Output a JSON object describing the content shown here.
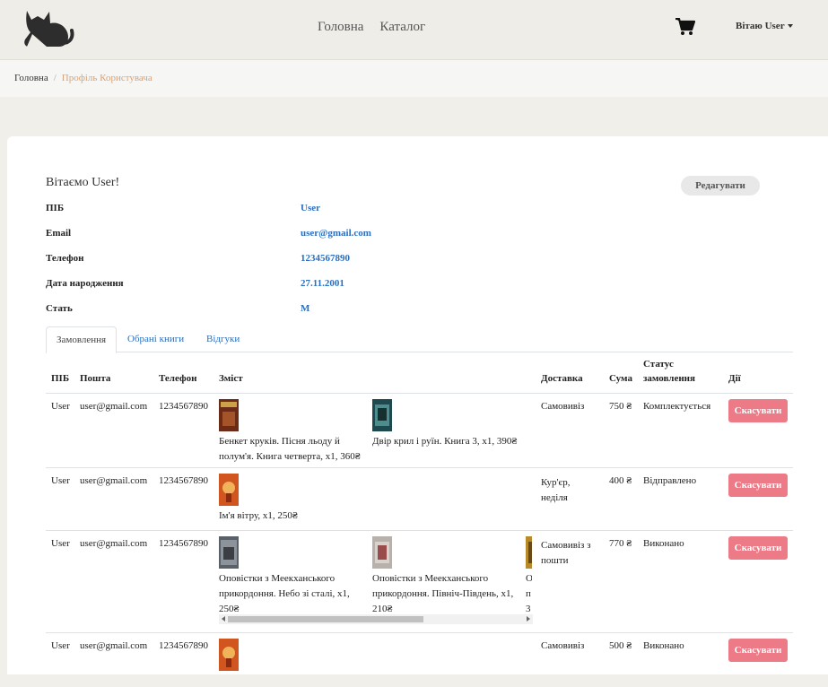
{
  "nav": {
    "home": "Головна",
    "catalog": "Каталог",
    "greeting": "Вітаю User"
  },
  "breadcrumb": {
    "home": "Головна",
    "separator": "/",
    "current": "Профіль Користувача"
  },
  "profile": {
    "welcome": "Вітаємо User!",
    "edit_label": "Редагувати",
    "fields": [
      {
        "label": "ПІБ",
        "value": "User"
      },
      {
        "label": "Email",
        "value": "user@gmail.com"
      },
      {
        "label": "Телефон",
        "value": "1234567890"
      },
      {
        "label": "Дата народження",
        "value": "27.11.2001"
      },
      {
        "label": "Стать",
        "value": "М"
      }
    ]
  },
  "tabs": [
    "Замовлення",
    "Обрані книги",
    "Відгуки"
  ],
  "orders": {
    "columns": [
      "ПІБ",
      "Пошта",
      "Телефон",
      "Зміст",
      "Доставка",
      "Сума",
      "Статус замовлення",
      "Дії"
    ],
    "cancel_label": "Скасувати",
    "rows": [
      {
        "name": "User",
        "email": "user@gmail.com",
        "phone": "1234567890",
        "items": [
          "Бенкет круків. Пісня льоду й полум'я. Книга четверта, x1, 360₴",
          "Двір крил і руїн. Книга 3, x1, 390₴"
        ],
        "delivery": "Самовивіз",
        "sum": "750 ₴",
        "status": "Комплектується"
      },
      {
        "name": "User",
        "email": "user@gmail.com",
        "phone": "1234567890",
        "items": [
          "Ім'я вітру, x1, 250₴"
        ],
        "delivery": "Кур'єр, неділя",
        "sum": "400 ₴",
        "status": "Відправлено"
      },
      {
        "name": "User",
        "email": "user@gmail.com",
        "phone": "1234567890",
        "items": [
          "Оповістки з Меекханського прикордоння. Небо зі сталі, x1, 250₴",
          "Оповістки з Меекханського прикордоння. Північ-Південь, x1, 210₴",
          "О п 3"
        ],
        "delivery": "Самовивіз з пошти",
        "sum": "770 ₴",
        "status": "Виконано"
      },
      {
        "name": "User",
        "email": "user@gmail.com",
        "phone": "1234567890",
        "items": [],
        "delivery": "Самовивіз",
        "sum": "500 ₴",
        "status": "Виконано"
      }
    ]
  },
  "colors": {
    "accent": "#2b6fbf",
    "cancel": "#ec7a87",
    "breadcrumb_active": "#d9a37a"
  },
  "icons": [
    "cat-logo-icon",
    "cart-icon",
    "caret-down-icon",
    "book-cover-icon"
  ]
}
